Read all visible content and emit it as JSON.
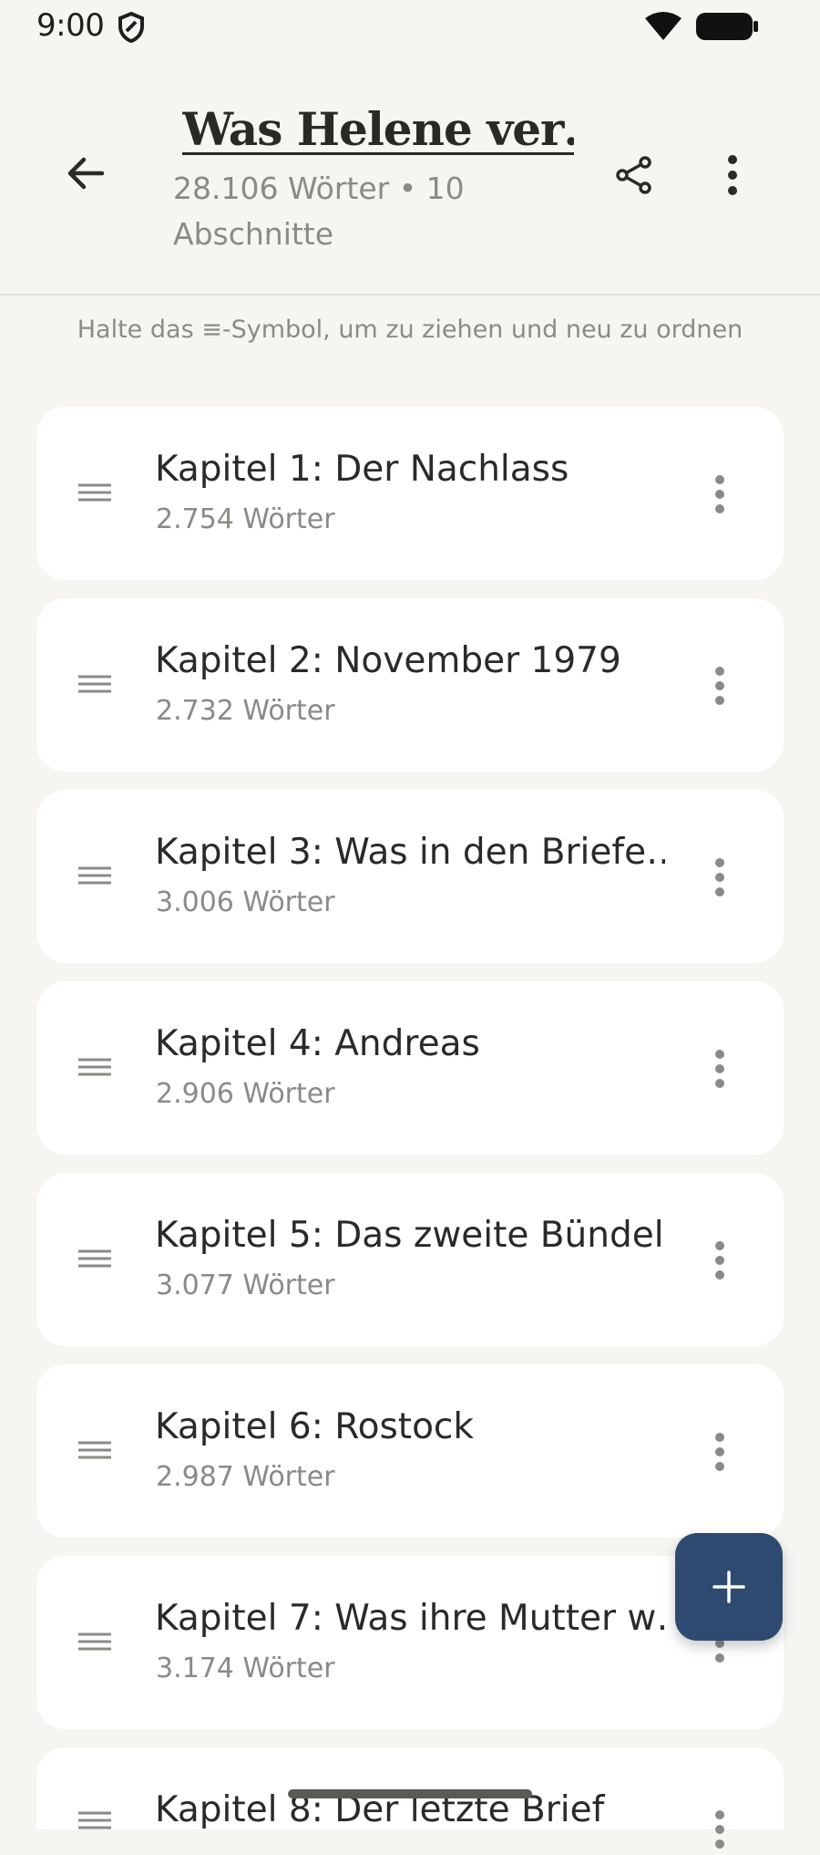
{
  "status_bar": {
    "time": "9:00"
  },
  "header": {
    "title": "Was Helene ver…",
    "subtitle": "28.106 Wörter • 10 Abschnitte"
  },
  "hint": "Halte das ≡-Symbol, um zu ziehen und neu zu ordnen",
  "chapters": [
    {
      "title": "Kapitel 1: Der Nachlass",
      "words": "2.754 Wörter"
    },
    {
      "title": "Kapitel 2: November 1979",
      "words": "2.732 Wörter"
    },
    {
      "title": "Kapitel 3: Was in den Briefe…",
      "words": "3.006 Wörter"
    },
    {
      "title": "Kapitel 4: Andreas",
      "words": "2.906 Wörter"
    },
    {
      "title": "Kapitel 5: Das zweite Bündel",
      "words": "3.077 Wörter"
    },
    {
      "title": "Kapitel 6: Rostock",
      "words": "2.987 Wörter"
    },
    {
      "title": "Kapitel 7: Was ihre Mutter w…",
      "words": "3.174 Wörter"
    },
    {
      "title": "Kapitel 8: Der letzte Brief",
      "words": ""
    }
  ],
  "icons": {
    "back": "arrow-left-icon",
    "share": "share-icon",
    "more": "more-vertical-icon",
    "drag": "drag-handle-icon",
    "add": "plus-icon"
  },
  "colors": {
    "background": "#f6f5f1",
    "card": "#ffffff",
    "fab": "#2e4a70",
    "muted_text": "#8c8a86"
  }
}
